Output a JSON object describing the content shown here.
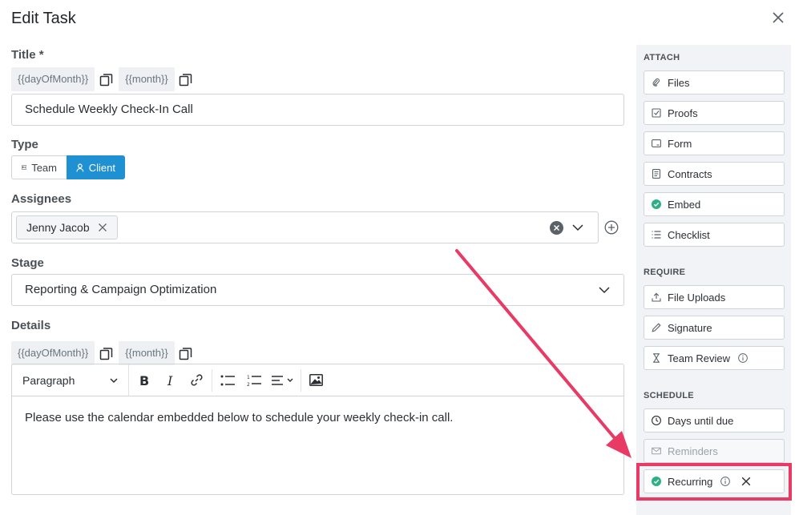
{
  "header": {
    "title": "Edit Task"
  },
  "title_field": {
    "label": "Title *",
    "tokens": [
      "{{dayOfMonth}}",
      "{{month}}"
    ],
    "value": "Schedule Weekly Check-In Call"
  },
  "type_field": {
    "label": "Type",
    "options": [
      {
        "label": "Team",
        "selected": false
      },
      {
        "label": "Client",
        "selected": true
      }
    ]
  },
  "assignees_field": {
    "label": "Assignees",
    "chips": [
      "Jenny Jacob"
    ]
  },
  "stage_field": {
    "label": "Stage",
    "value": "Reporting & Campaign Optimization"
  },
  "details_field": {
    "label": "Details",
    "tokens": [
      "{{dayOfMonth}}",
      "{{month}}"
    ],
    "toolbar": {
      "block_format": "Paragraph"
    },
    "body": "Please use the calendar embedded below to schedule your weekly check-in call."
  },
  "sidebar": {
    "attach": {
      "heading": "ATTACH",
      "items": [
        {
          "label": "Files",
          "icon": "paperclip-icon"
        },
        {
          "label": "Proofs",
          "icon": "checkbox-icon"
        },
        {
          "label": "Form",
          "icon": "form-icon"
        },
        {
          "label": "Contracts",
          "icon": "document-icon"
        },
        {
          "label": "Embed",
          "icon": "check-circle-icon"
        },
        {
          "label": "Checklist",
          "icon": "checklist-icon"
        }
      ]
    },
    "require": {
      "heading": "REQUIRE",
      "items": [
        {
          "label": "File Uploads",
          "icon": "upload-icon"
        },
        {
          "label": "Signature",
          "icon": "pen-icon"
        },
        {
          "label": "Team Review",
          "icon": "hourglass-icon"
        }
      ]
    },
    "schedule": {
      "heading": "SCHEDULE",
      "items": [
        {
          "label": "Days until due",
          "icon": "clock-icon"
        },
        {
          "label": "Reminders",
          "icon": "mail-icon",
          "disabled": true
        },
        {
          "label": "Recurring",
          "icon": "check-circle-icon"
        }
      ]
    }
  },
  "colors": {
    "accent": "#1f90d2",
    "success": "#2eb086",
    "annotation": "#e83a64"
  }
}
